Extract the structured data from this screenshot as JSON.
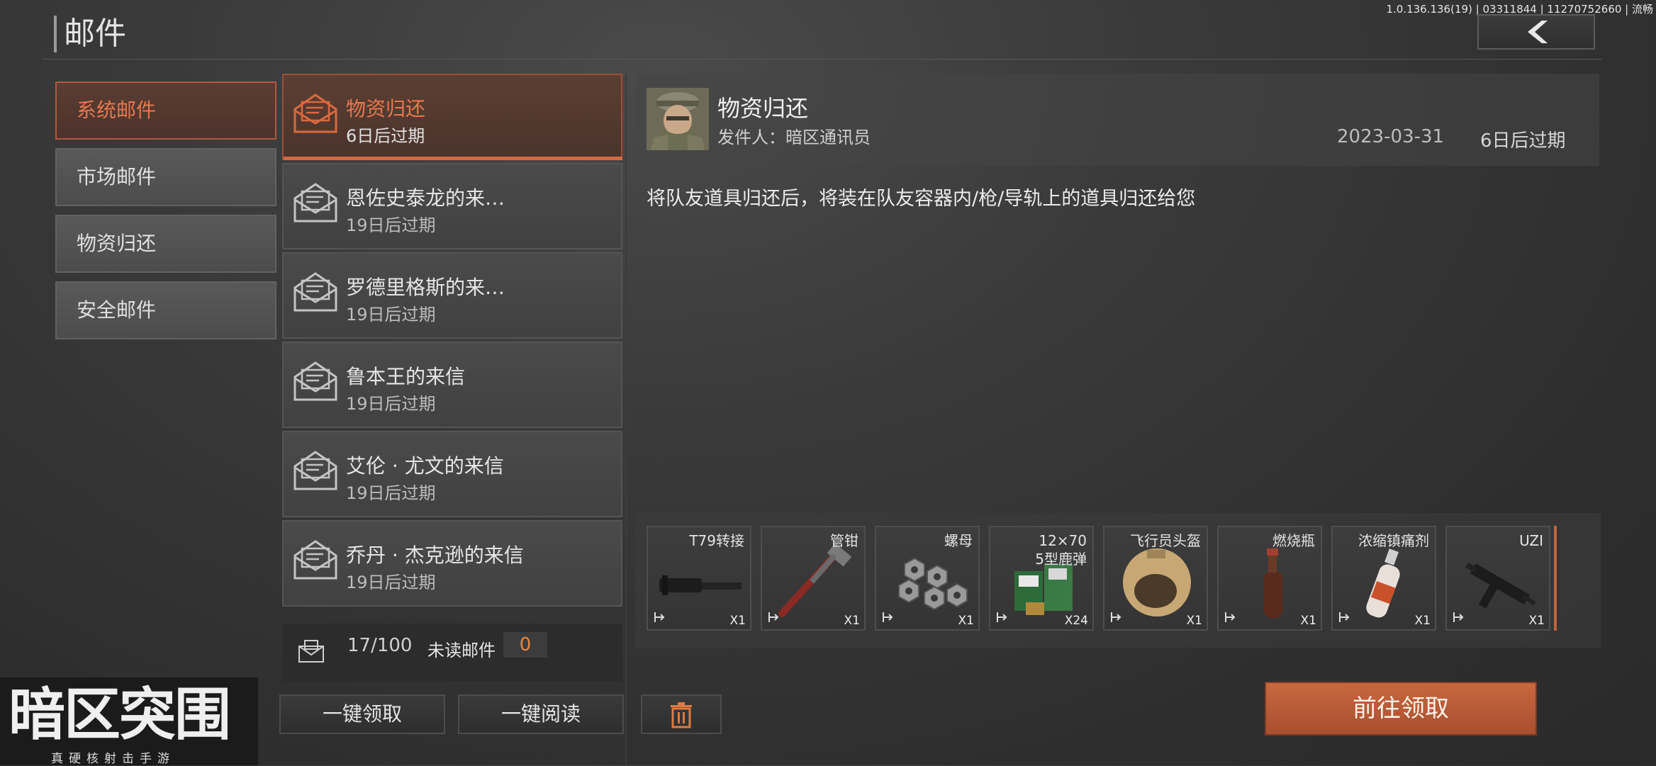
{
  "header": {
    "title": "邮件",
    "version": "1.0.136.136(19) | 03311844 | 11270752660 | 流畅"
  },
  "categories": [
    {
      "label": "系统邮件",
      "active": true
    },
    {
      "label": "市场邮件",
      "active": false
    },
    {
      "label": "物资归还",
      "active": false
    },
    {
      "label": "安全邮件",
      "active": false
    }
  ],
  "mails": [
    {
      "title": "物资归还",
      "expire": "6日后过期",
      "active": true
    },
    {
      "title": "恩佐史泰龙的来…",
      "expire": "19日后过期"
    },
    {
      "title": "罗德里格斯的来…",
      "expire": "19日后过期"
    },
    {
      "title": "鲁本王的来信",
      "expire": "19日后过期"
    },
    {
      "title": "艾伦 · 尤文的来信",
      "expire": "19日后过期"
    },
    {
      "title": "乔丹 · 杰克逊的来信",
      "expire": "19日后过期"
    }
  ],
  "footer": {
    "count": "17/100",
    "unread_label": "未读邮件",
    "unread_count": "0"
  },
  "buttons": {
    "claim_all": "一键领取",
    "read_all": "一键阅读",
    "go_claim": "前往领取"
  },
  "detail": {
    "title": "物资归还",
    "sender": "发件人：暗区通讯员",
    "date": "2023-03-31",
    "expire": "6日后过期",
    "body": "将队友道具归还后，将装在队友容器内/枪/导轨上的道具归还给您"
  },
  "attachments": [
    {
      "name": "T79转接",
      "qty": "X1",
      "art": "adapter"
    },
    {
      "name": "管钳",
      "qty": "X1",
      "art": "wrench"
    },
    {
      "name": "螺母",
      "qty": "X1",
      "art": "nuts"
    },
    {
      "name": "12×70\n5型鹿弹",
      "qty": "X24",
      "art": "shells"
    },
    {
      "name": "飞行员头盔",
      "qty": "X1",
      "art": "helmet"
    },
    {
      "name": "燃烧瓶",
      "qty": "X1",
      "art": "molotov"
    },
    {
      "name": "浓缩镇痛剂",
      "qty": "X1",
      "art": "spray"
    },
    {
      "name": "UZI",
      "qty": "X1",
      "art": "uzi"
    }
  ],
  "logo": {
    "name": "暗区突围",
    "tagline": "真硬核射击手游"
  },
  "colors": {
    "accent": "#e8784e",
    "button": "#b85a35"
  }
}
